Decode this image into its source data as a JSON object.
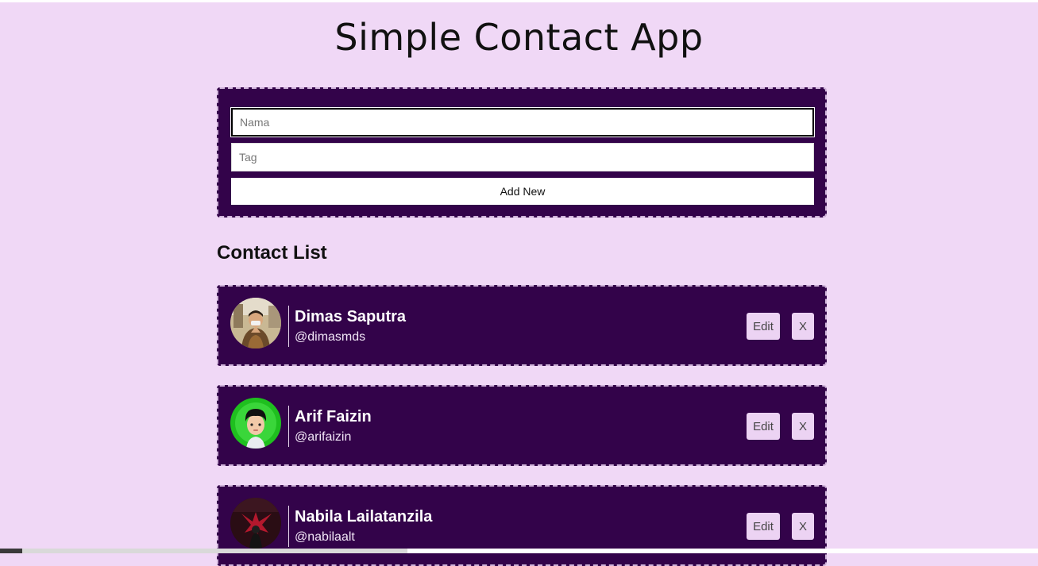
{
  "app": {
    "title": "Simple Contact App"
  },
  "form": {
    "name_placeholder": "Nama",
    "tag_placeholder": "Tag",
    "name_value": "",
    "tag_value": "",
    "add_label": "Add New"
  },
  "list": {
    "title": "Contact List",
    "contacts": [
      {
        "name": "Dimas Saputra",
        "tag": "@dimasmds",
        "edit_label": "Edit",
        "delete_label": "X"
      },
      {
        "name": "Arif Faizin",
        "tag": "@arifaizin",
        "edit_label": "Edit",
        "delete_label": "X"
      },
      {
        "name": "Nabila Lailatanzila",
        "tag": "@nabilaalt",
        "edit_label": "Edit",
        "delete_label": "X"
      }
    ]
  },
  "colors": {
    "background": "#f0d8f6",
    "card": "#33034a",
    "card_border": "#cfb3d9",
    "button_bg": "#ecd3f3"
  }
}
